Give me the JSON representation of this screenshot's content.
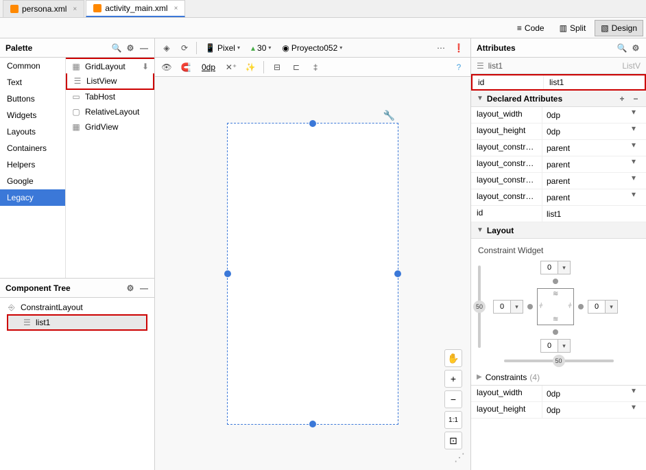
{
  "tabs": [
    {
      "label": "persona.xml",
      "active": false
    },
    {
      "label": "activity_main.xml",
      "active": true
    }
  ],
  "view_modes": {
    "code": "Code",
    "split": "Split",
    "design": "Design"
  },
  "palette": {
    "title": "Palette",
    "categories": [
      "Common",
      "Text",
      "Buttons",
      "Widgets",
      "Layouts",
      "Containers",
      "Helpers",
      "Google",
      "Legacy"
    ],
    "selected_category": "Legacy",
    "items": [
      "GridLayout",
      "ListView",
      "TabHost",
      "RelativeLayout",
      "GridView"
    ],
    "highlighted_item": "ListView"
  },
  "component_tree": {
    "title": "Component Tree",
    "root": "ConstraintLayout",
    "child": "list1"
  },
  "design_toolbar": {
    "device": "Pixel",
    "api": "30",
    "project": "Proyecto052",
    "default_margin": "0dp"
  },
  "zoom": {
    "plus": "+",
    "minus": "−",
    "fit": "1:1",
    "pan": "✋"
  },
  "attributes": {
    "title": "Attributes",
    "component_name": "list1",
    "component_type": "ListV",
    "id_label": "id",
    "id_value": "list1",
    "declared_title": "Declared Attributes",
    "declared": [
      {
        "label": "layout_width",
        "value": "0dp"
      },
      {
        "label": "layout_height",
        "value": "0dp"
      },
      {
        "label": "layout_constrai...",
        "value": "parent"
      },
      {
        "label": "layout_constrai...",
        "value": "parent"
      },
      {
        "label": "layout_constrai...",
        "value": "parent"
      },
      {
        "label": "layout_constrai...",
        "value": "parent"
      },
      {
        "label": "id",
        "value": "list1"
      }
    ],
    "layout_title": "Layout",
    "constraint_label": "Constraint Widget",
    "cw_values": {
      "top": "0",
      "left": "0",
      "right": "0",
      "bottom": "0",
      "bias_h": "50",
      "bias_v": "50"
    },
    "constraints_title": "Constraints",
    "constraints_count": "(4)",
    "bottom_attrs": [
      {
        "label": "layout_width",
        "value": "0dp"
      },
      {
        "label": "layout_height",
        "value": "0dp"
      }
    ]
  }
}
